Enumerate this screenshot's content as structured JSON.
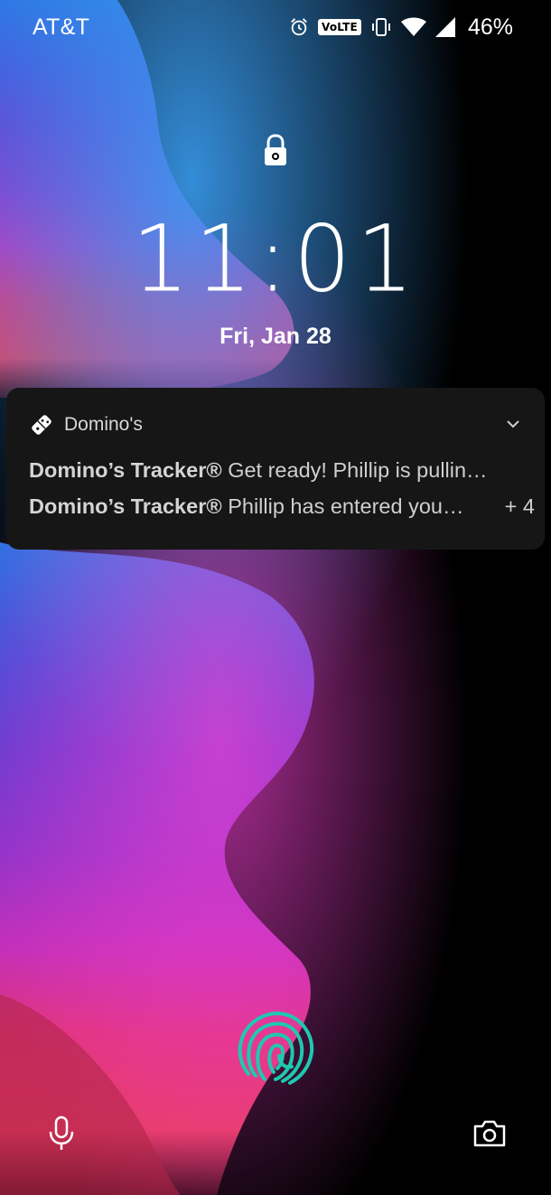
{
  "status_bar": {
    "carrier": "AT&T",
    "volte": "VoLTE",
    "battery_percent": "46%",
    "icons": [
      "alarm-icon",
      "volte-icon",
      "vibrate-icon",
      "wifi-icon",
      "signal-icon"
    ]
  },
  "lockscreen": {
    "time": "11:01",
    "date": "Fri, Jan 28",
    "lock_icon": "padlock-icon"
  },
  "notification": {
    "app_name": "Domino's",
    "app_icon": "domino-icon",
    "lines": [
      {
        "title": "Domino’s Tracker®",
        "text": " Get ready! Phillip is pullin…"
      },
      {
        "title": "Domino’s Tracker®",
        "text": " Phillip has entered you…"
      }
    ],
    "more_count": "+ 4"
  },
  "shortcuts": {
    "left_icon": "microphone-icon",
    "right_icon": "camera-icon",
    "fingerprint_icon": "fingerprint-icon"
  },
  "colors": {
    "fingerprint": "#1ec9b0",
    "card_bg": "#161616"
  }
}
